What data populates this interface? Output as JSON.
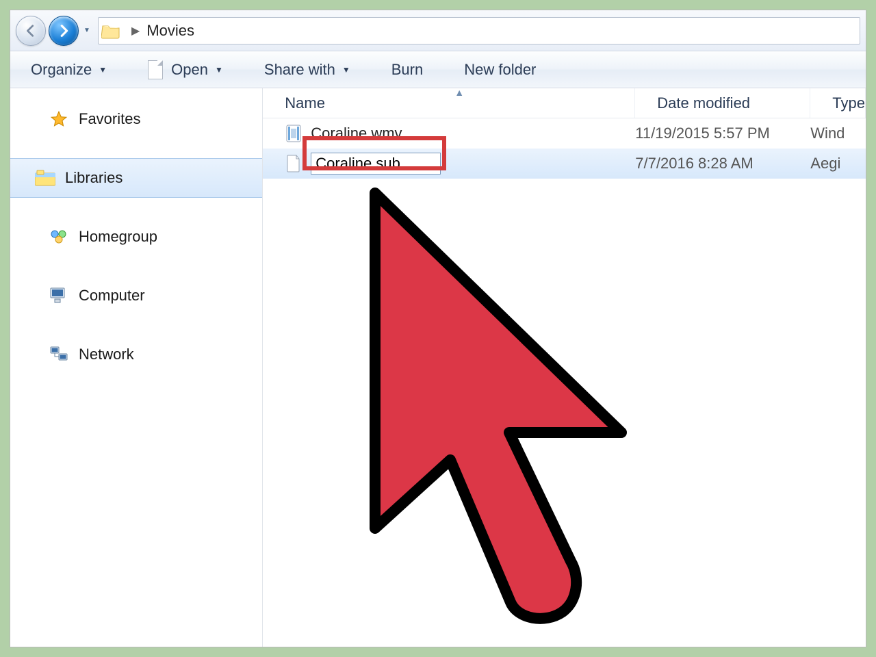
{
  "nav": {
    "breadcrumb_sep": "▶",
    "folder_name": "Movies"
  },
  "toolbar": {
    "organize": "Organize",
    "open": "Open",
    "share_with": "Share with",
    "burn": "Burn",
    "new_folder": "New folder"
  },
  "sidebar": {
    "favorites": "Favorites",
    "libraries": "Libraries",
    "homegroup": "Homegroup",
    "computer": "Computer",
    "network": "Network"
  },
  "columns": {
    "name": "Name",
    "date": "Date modified",
    "type": "Type"
  },
  "files": [
    {
      "name": "Coraline.wmv",
      "date": "11/19/2015 5:57 PM",
      "type": "Wind"
    },
    {
      "name": "Coraline.sub",
      "date": "7/7/2016 8:28 AM",
      "type": "Aegi"
    }
  ],
  "rename_value": "Coraline.sub"
}
